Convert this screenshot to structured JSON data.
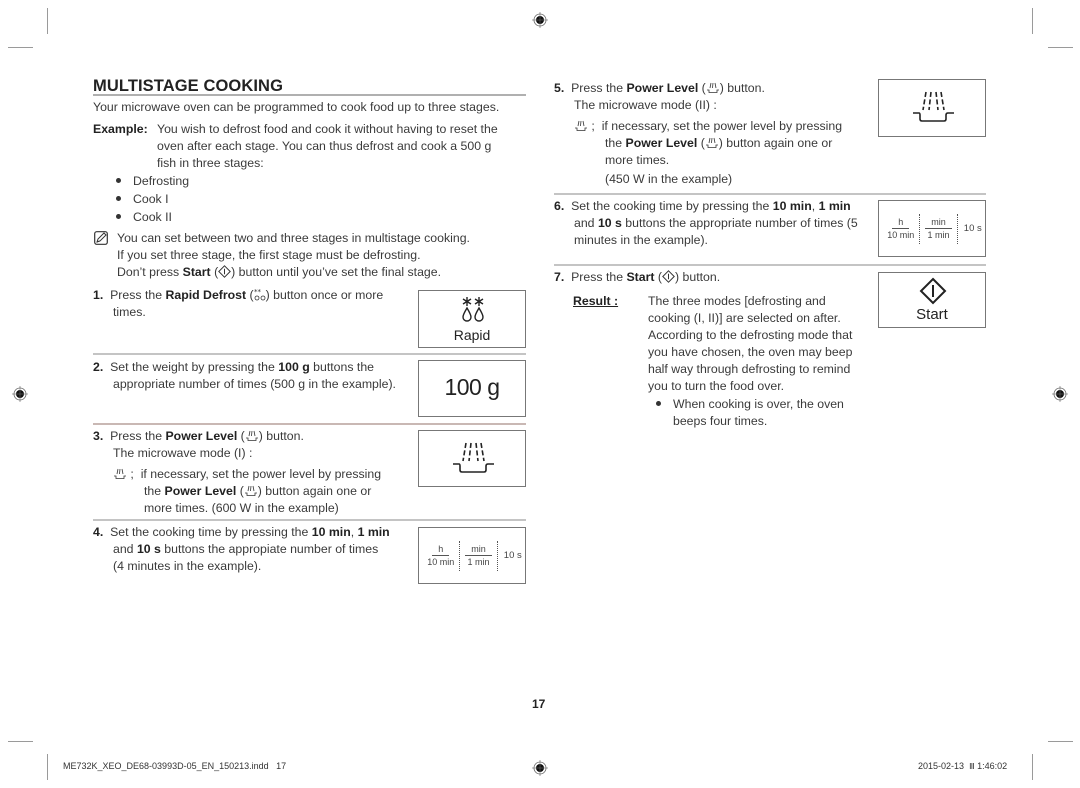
{
  "page": {
    "title": "MULTISTAGE COOKING",
    "intro": "Your microwave oven can be programmed to cook food up to three stages.",
    "example": {
      "label": "Example:",
      "lines": [
        "You wish to defrost food and cook it without having to reset the",
        "oven after each stage. You can thus defrost and cook a 500 g",
        "fish in three stages:"
      ]
    },
    "stages": [
      "Defrosting",
      "Cook I",
      "Cook II"
    ],
    "note": {
      "icon": "note-icon",
      "lines": [
        "You can set between two and three stages in multistage cooking.",
        "If you set three stage, the first stage must be defrosting."
      ],
      "line3_pre": "Don’t press ",
      "line3_bold": "Start",
      "line3_mid": " (",
      "line3_post": ") button until you’ve set the final stage."
    },
    "steps": {
      "s1": {
        "num": "1.",
        "pre": "Press the ",
        "bold": "Rapid Defrost",
        "post1": " (",
        "post2": ") button once or more",
        "line2": "times.",
        "panel_label": "Rapid"
      },
      "s2": {
        "num": "2.",
        "pre": "Set the weight by pressing the ",
        "bold": "100 g",
        "post": " buttons the",
        "line2": "appropriate number of times (500 g in the example).",
        "panel_label": "100 g"
      },
      "s3": {
        "num": "3.",
        "pre": "Press the ",
        "bold": "Power Level",
        "post": ") button.",
        "line2": "The microwave mode (I) :",
        "sub_sep": ";",
        "sub1_pre": "if necessary, set the power level by pressing",
        "sub2_pre": "the ",
        "sub2_bold": "Power Level",
        "sub2_post": ") button again one or",
        "sub3": "more times. (600 W in the example)"
      },
      "s4": {
        "num": "4.",
        "pre": "Set the cooking time by pressing the ",
        "bold1": "10 min",
        "comma": ", ",
        "bold2": "1 min",
        "l2_pre": "and ",
        "l2_bold": "10 s",
        "l2_post": " buttons the appropiate number of times",
        "line3": "(4 minutes in the example)."
      },
      "s5": {
        "num": "5.",
        "pre": "Press the ",
        "bold": "Power Level",
        "post": ") button.",
        "line2": "The microwave mode (II) :",
        "sub_sep": ";",
        "sub1_pre": "if necessary, set the power level by pressing",
        "sub2_pre": "the ",
        "sub2_bold": "Power Level",
        "sub2_post": ") button again one or",
        "sub3": "more times.",
        "sub4": "(450 W in the example)"
      },
      "s6": {
        "num": "6.",
        "pre": "Set the cooking time by pressing the ",
        "bold1": "10 min",
        "comma": ", ",
        "bold2": "1 min",
        "l2_pre": "and ",
        "l2_bold": "10 s",
        "l2_post": " buttons the appropriate number of times (5",
        "line3": "minutes in the example)."
      },
      "s7": {
        "num": "7.",
        "pre": "Press the ",
        "bold": "Start",
        "post": ") button.",
        "result_label": "Result :",
        "result_lines": [
          "The three modes [defrosting and",
          "cooking (I, II)] are selected on after.",
          "According to the defrosting mode that",
          "you have chosen, the oven may beep",
          "half way through defrosting to remind",
          "you to turn the food over."
        ],
        "bullet_lines": [
          "When cooking is over, the oven",
          "beeps four times."
        ],
        "panel_label": "Start"
      }
    },
    "timer_panel": {
      "h": "h",
      "ten_min": "10 min",
      "min": "min",
      "one_min": "1 min",
      "ten_s": "10 s"
    },
    "page_number": "17",
    "footer": {
      "file": "ME732K_XEO_DE68-03993D-05_EN_150213.indd   17",
      "date": "2015-02-13",
      "time_glyph": "Ⅲ",
      "time": "1:46:02"
    }
  }
}
